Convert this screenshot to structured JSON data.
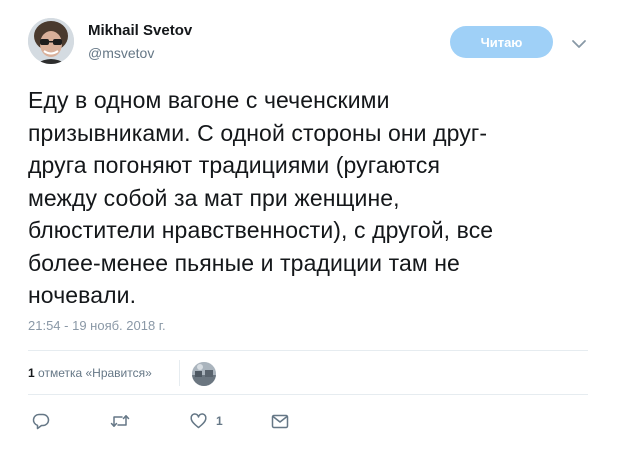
{
  "author": {
    "name": "Mikhail Svetov",
    "handle": "@msvetov"
  },
  "follow_button": {
    "label": "Читаю",
    "color": "#9fd0f7"
  },
  "tweet": {
    "text": "Еду в одном вагоне с чеченскими\nпризывниками. С одной стороны они друг-\nдруга погоняют традициями (ругаются\nмежду собой за мат при женщине,\nблюстители нравственности), с другой, все\nболее-менее пьяные и традиции там не\nночевали.",
    "timestamp": "21:54 - 19 нояб. 2018 г."
  },
  "likes_summary": {
    "count": "1",
    "label": "отметка «Нравится»"
  },
  "actions": {
    "reply_icon": "reply-icon",
    "retweet_icon": "retweet-icon",
    "like_icon": "heart-icon",
    "like_count": "1",
    "dm_icon": "envelope-icon"
  },
  "colors": {
    "text": "#14171a",
    "secondary": "#657786",
    "divider": "#e6ecf0"
  }
}
